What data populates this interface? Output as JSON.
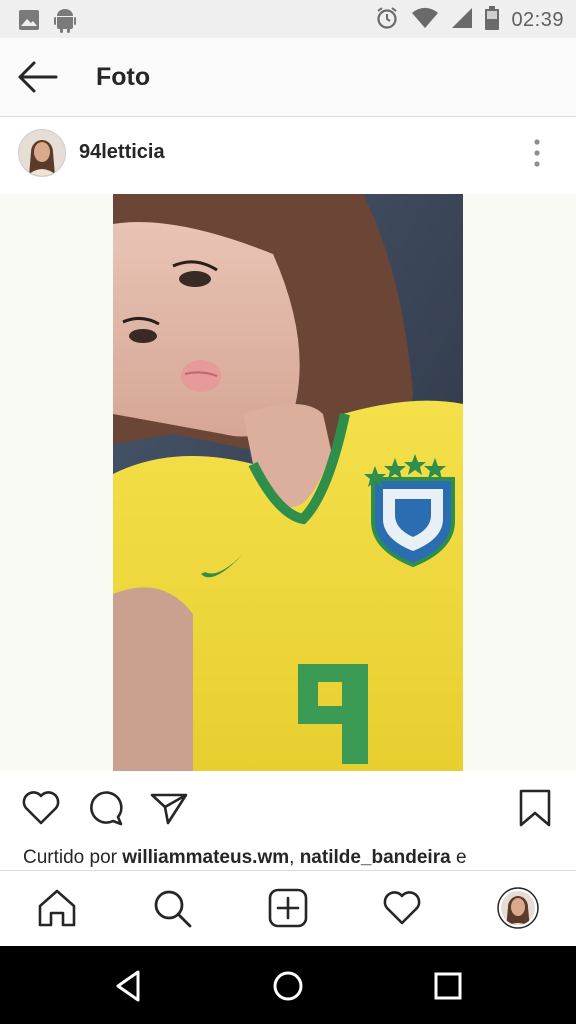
{
  "status_bar": {
    "time": "02:39",
    "icons": [
      "image-icon",
      "android-icon",
      "alarm-icon",
      "wifi-icon",
      "signal-icon",
      "battery-icon"
    ]
  },
  "header": {
    "title": "Foto",
    "back_icon": "arrow-left-icon"
  },
  "post": {
    "username": "94letticia",
    "more_icon": "more-vertical-icon",
    "photo_description": "selfie-photo",
    "liked_prefix": "Curtido por ",
    "liked_user_1": "williammateus.wm",
    "liked_sep": ", ",
    "liked_user_2": "natilde_bandeira",
    "liked_suffix": " e"
  },
  "actions": [
    "heart-icon",
    "comment-icon",
    "share-icon",
    "bookmark-icon"
  ],
  "bottom_nav": [
    "home-icon",
    "search-icon",
    "add-icon",
    "activity-icon",
    "profile-avatar"
  ],
  "system_nav": [
    "back-triangle-icon",
    "home-circle-icon",
    "recents-square-icon"
  ],
  "colors": {
    "jersey_yellow": "#f2dc3c",
    "jersey_green": "#2f8f4a",
    "crest_blue": "#2a6db0",
    "text": "#262626"
  }
}
